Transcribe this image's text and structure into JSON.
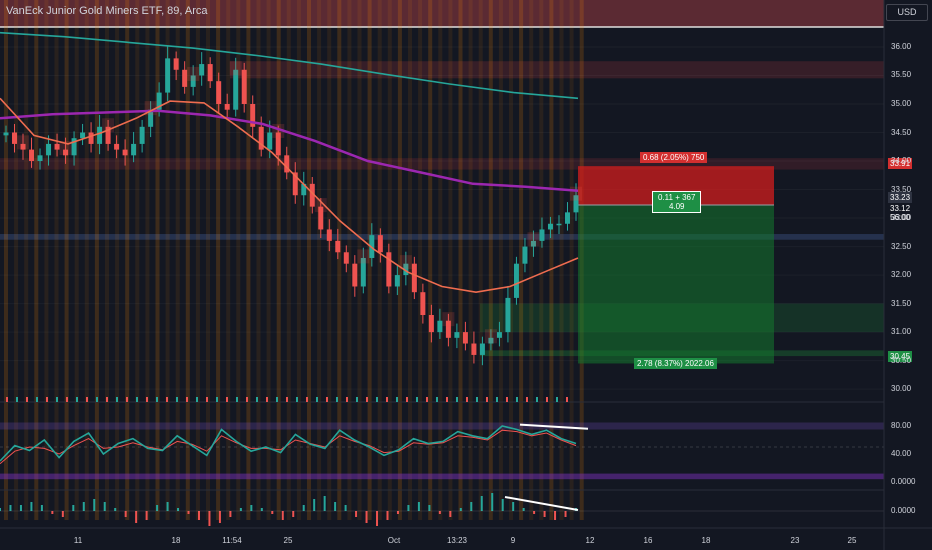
{
  "header": {
    "title": "VanEck Junior Gold Miners ETF, 89, Arca",
    "currency": "USD"
  },
  "price_tags": {
    "stop": "33.91",
    "last": "33.23",
    "last_sub": "33.12",
    "countdown": "56:00",
    "target": "30.45"
  },
  "position_labels": {
    "risk": "0.68 (2.05%) 750",
    "current": "0.11 + 367",
    "ratio": "4.09",
    "reward": "2.78 (8.37%) 2022.06"
  },
  "colors": {
    "background": "#131722",
    "bull": "#26a69a",
    "bear": "#ef5350",
    "ma_teal": "#26a69a",
    "ma_purple": "#9c27b0",
    "ma_orange": "#ef6c4f",
    "risk_zone": "#d32f2f",
    "reward_zone": "#1b8a3c"
  },
  "icons": [
    "currency-selector"
  ],
  "chart_data": [
    {
      "type": "candlestick",
      "title": "VanEck Junior Gold Miners ETF, 89, Arca",
      "ylim": [
        29.95,
        36.35
      ],
      "y_ticks": [
        "36.00",
        "35.50",
        "35.00",
        "34.50",
        "34.00",
        "33.50",
        "33.00",
        "32.50",
        "32.00",
        "31.50",
        "31.00",
        "30.50",
        "30.00"
      ],
      "x_ticks": [
        "11",
        "18",
        "11:54",
        "25",
        "Oct",
        "13:23",
        "9",
        "12",
        "16",
        "18",
        "23",
        "25"
      ],
      "close_path": [
        34.5,
        34.3,
        34.2,
        34.0,
        34.1,
        34.3,
        34.2,
        34.1,
        34.4,
        34.5,
        34.3,
        34.6,
        34.3,
        34.2,
        34.1,
        34.3,
        34.6,
        34.9,
        35.2,
        35.8,
        35.6,
        35.3,
        35.5,
        35.7,
        35.4,
        35.0,
        34.9,
        35.6,
        35.0,
        34.6,
        34.2,
        34.5,
        34.1,
        33.8,
        33.4,
        33.6,
        33.2,
        32.8,
        32.6,
        32.4,
        32.2,
        31.8,
        32.3,
        32.7,
        32.4,
        31.8,
        32.0,
        32.2,
        31.7,
        31.3,
        31.0,
        31.2,
        30.9,
        31.0,
        30.8,
        30.6,
        30.8,
        30.9,
        31.0,
        31.6,
        32.2,
        32.5,
        32.6,
        32.8,
        32.9,
        32.9,
        33.1,
        33.4
      ]
    },
    {
      "type": "line",
      "series": [
        {
          "name": "",
          "color": "#26a69a",
          "values": [
            36.25,
            36.18,
            36.08,
            35.98,
            35.85,
            35.7,
            35.52,
            35.35,
            35.2,
            35.1
          ]
        },
        {
          "name": "",
          "color": "#9c27b0",
          "values": [
            34.75,
            34.82,
            34.85,
            34.88,
            34.8,
            34.65,
            34.35,
            34.0,
            33.8,
            33.6,
            33.55,
            33.48
          ]
        },
        {
          "name": "",
          "color": "#ef6c4f",
          "values": [
            35.1,
            34.45,
            34.3,
            34.5,
            34.75,
            35.05,
            35.02,
            34.6,
            34.15,
            33.55,
            32.95,
            32.45,
            32.05,
            31.8,
            31.7,
            31.8,
            32.05,
            32.3
          ]
        }
      ]
    },
    {
      "type": "line",
      "title": "",
      "ylim": [
        0,
        100
      ],
      "y_ticks": [
        "80.00",
        "40.00",
        "0.0000"
      ],
      "series": [
        {
          "name": "",
          "color": "#26a69a",
          "values": [
            30,
            52,
            45,
            60,
            35,
            58,
            70,
            40,
            55,
            62,
            48,
            45,
            66,
            52,
            38,
            75,
            58,
            44,
            50,
            42,
            68,
            54,
            48,
            74,
            60,
            50,
            38,
            46,
            62,
            55,
            58,
            72,
            66,
            62,
            80,
            75,
            68,
            74,
            62,
            55
          ]
        },
        {
          "name": "",
          "color": "#ef5350",
          "values": [
            26,
            44,
            50,
            48,
            40,
            52,
            62,
            48,
            50,
            56,
            50,
            46,
            58,
            54,
            44,
            66,
            56,
            48,
            48,
            46,
            60,
            55,
            50,
            66,
            58,
            52,
            42,
            44,
            56,
            54,
            56,
            66,
            64,
            60,
            74,
            72,
            66,
            70,
            60,
            52
          ]
        }
      ]
    },
    {
      "type": "bar",
      "title": "",
      "y_ticks": [
        "0.0000"
      ],
      "values": [
        1,
        2,
        2,
        3,
        2,
        -1,
        -2,
        2,
        3,
        4,
        3,
        1,
        -2,
        -4,
        -3,
        2,
        3,
        1,
        -1,
        -3,
        -5,
        -4,
        -2,
        1,
        2,
        1,
        -1,
        -3,
        -2,
        2,
        4,
        5,
        3,
        2,
        -2,
        -4,
        -5,
        -3,
        -1,
        2,
        3,
        2,
        -1,
        -2,
        1,
        3,
        5,
        6,
        4,
        3,
        1,
        -1,
        -2,
        -3,
        -2,
        1
      ]
    }
  ]
}
